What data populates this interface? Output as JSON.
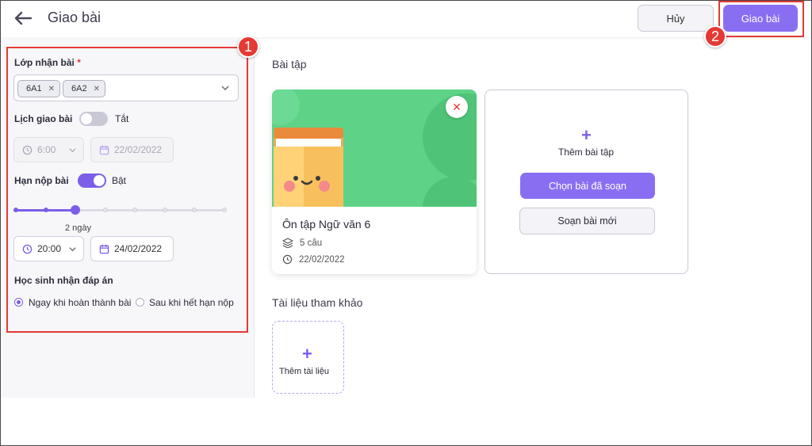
{
  "header": {
    "title": "Giao bài",
    "cancel_label": "Hủy",
    "submit_label": "Giao bài"
  },
  "annotations": {
    "badge1": "1",
    "badge2": "2"
  },
  "form": {
    "classes_label": "Lớp nhận bài",
    "required_mark": "*",
    "classes": [
      {
        "name": "6A1"
      },
      {
        "name": "6A2"
      }
    ],
    "schedule": {
      "label": "Lịch giao bài",
      "state_text": "Tắt",
      "enabled": false,
      "time": "6:00",
      "date": "22/02/2022"
    },
    "deadline": {
      "label": "Hạn nộp bài",
      "state_text": "Bật",
      "enabled": true,
      "slider_caption": "2 ngày",
      "slider_value_index": 2,
      "slider_steps": 8,
      "time": "20:00",
      "date": "24/02/2022"
    },
    "answers": {
      "label": "Học sinh nhận đáp án",
      "options": [
        {
          "label": "Ngay khi hoàn thành bài",
          "selected": true
        },
        {
          "label": "Sau khi hết hạn nộp",
          "selected": false
        }
      ]
    }
  },
  "exercises": {
    "section_title": "Bài tập",
    "card": {
      "title": "Ôn tập Ngữ văn 6",
      "questions": "5 câu",
      "date": "22/02/2022"
    },
    "add": {
      "label": "Thêm bài tập",
      "choose_label": "Chọn bài đã soạn",
      "new_label": "Soạn bài mới"
    }
  },
  "references": {
    "section_title": "Tài liệu tham khảo",
    "add_label": "Thêm tài liệu"
  },
  "colors": {
    "accent": "#8a6ef2",
    "highlight": "#e53935",
    "card_bg": "#5ed387"
  }
}
